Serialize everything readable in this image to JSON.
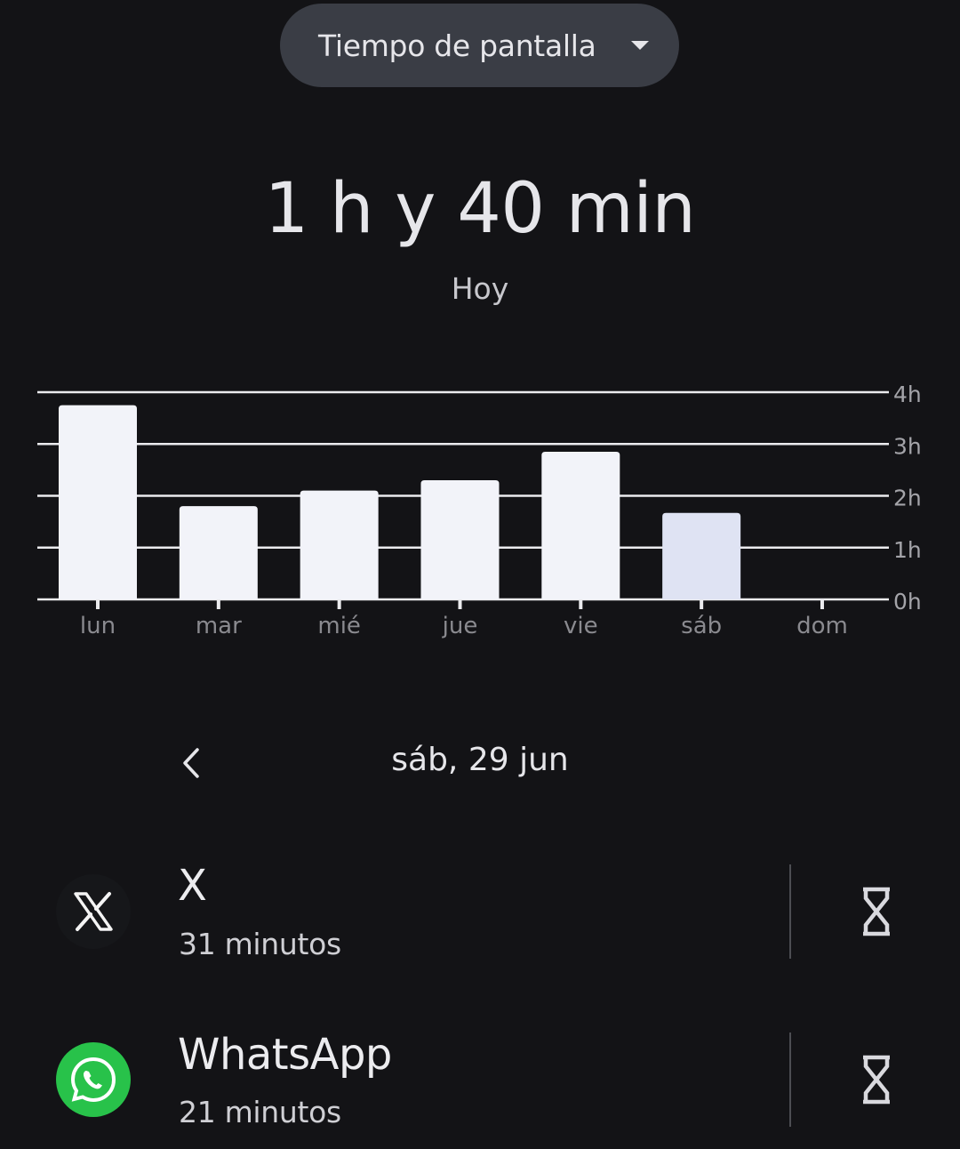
{
  "header": {
    "dropdown_label": "Tiempo de pantalla"
  },
  "summary": {
    "total": "1 h y 40 min",
    "caption": "Hoy"
  },
  "chart_data": {
    "type": "bar",
    "categories": [
      "lun",
      "mar",
      "mié",
      "jue",
      "vie",
      "sáb",
      "dom"
    ],
    "values": [
      3.75,
      1.8,
      2.1,
      2.3,
      2.85,
      1.67,
      0
    ],
    "selected_index": 5,
    "y_ticks": [
      "0h",
      "1h",
      "2h",
      "3h",
      "4h"
    ],
    "ylim": [
      0,
      4
    ],
    "grid": true,
    "colors": {
      "bar": "#f2f3f9",
      "bar_selected": "#dfe3f3",
      "grid": "#ebebee",
      "tick_text": "#a4a4a9",
      "x_label": "#8a8a8f"
    }
  },
  "date_nav": {
    "date": "sáb, 29 jun",
    "prev_icon": "chevron-left-icon"
  },
  "apps": [
    {
      "name": "X",
      "time": "31 minutos",
      "icon": "x-logo-icon",
      "timer_icon": "hourglass-icon"
    },
    {
      "name": "WhatsApp",
      "time": "21 minutos",
      "icon": "whatsapp-logo-icon",
      "timer_icon": "hourglass-icon"
    }
  ],
  "colors": {
    "background": "#131316",
    "chip": "#3a3d45",
    "whatsapp_green": "#28c24a"
  }
}
